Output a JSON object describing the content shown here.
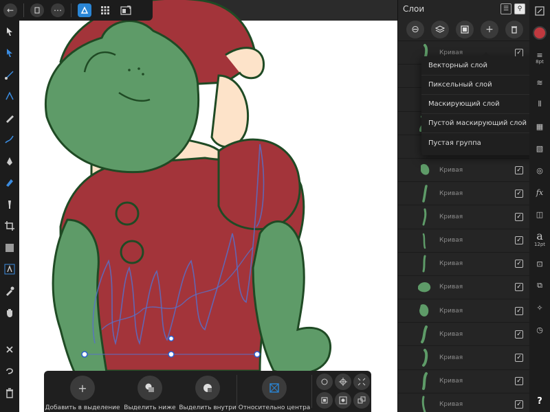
{
  "layers_panel": {
    "title": "Слои",
    "layer_name": "Кривая",
    "check_glyph": "✓",
    "layers": [
      {
        "name": "Кривая",
        "visible": true
      },
      {
        "name": "Кривая",
        "visible": true
      },
      {
        "name": "Кривая",
        "visible": true
      },
      {
        "name": "Кривая",
        "visible": true
      },
      {
        "name": "Кривая",
        "visible": true
      },
      {
        "name": "Кривая",
        "visible": true
      },
      {
        "name": "Кривая",
        "visible": true
      },
      {
        "name": "Кривая",
        "visible": true
      },
      {
        "name": "Кривая",
        "visible": true
      },
      {
        "name": "Кривая",
        "visible": true
      },
      {
        "name": "Кривая",
        "visible": true
      },
      {
        "name": "Кривая",
        "visible": true
      },
      {
        "name": "Кривая",
        "visible": true
      },
      {
        "name": "Кривая",
        "visible": true
      },
      {
        "name": "Кривая",
        "visible": true
      },
      {
        "name": "Кривая",
        "visible": true
      }
    ]
  },
  "add_layer_menu": {
    "items": [
      "Векторный слой",
      "Пиксельный слой",
      "Маскирующий слой",
      "Пустой маскирующий слой",
      "Пустая группа"
    ]
  },
  "context_toolbar": {
    "add_to_selection": "Добавить в выделение",
    "select_below": "Выделить ниже",
    "select_inside": "Выделить внутри",
    "relative_to_center": "Относительно центра"
  },
  "right_toolbar": {
    "stroke_size": "8pt",
    "font_size": "12pt",
    "fx_label": "fx",
    "font_glyph": "a",
    "help": "?"
  },
  "colors": {
    "accent": "#2a86d6",
    "fill_color": "#c0393f",
    "thumb_green": "#5e9b68"
  }
}
